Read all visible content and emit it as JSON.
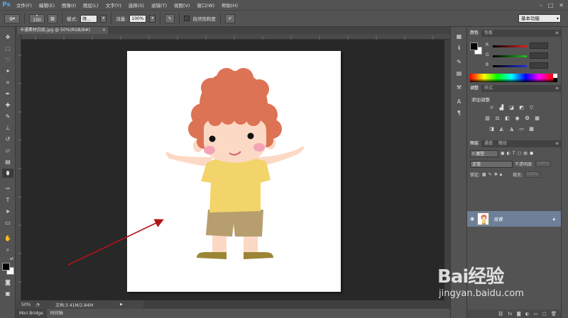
{
  "menubar": {
    "logo": "Ps",
    "items": [
      "文件(F)",
      "编辑(E)",
      "图像(I)",
      "图层(L)",
      "文字(Y)",
      "选择(S)",
      "滤镜(T)",
      "视图(V)",
      "窗口(W)",
      "帮助(H)"
    ],
    "window_controls": [
      "–",
      "□",
      "✕"
    ]
  },
  "options": {
    "brush_size": "150",
    "mode_label": "模式:",
    "mode_value": "降...",
    "flow_label": "流量:",
    "flow_value": "100%",
    "checkbox_label": "自然饱和度",
    "workspace": "基本功能"
  },
  "document": {
    "tab_title": "卡通素材白底.jpg @ 50%(RGB/8#)",
    "tab_close": "×",
    "zoom": "50%",
    "info": "文档:3.41M/2.84M",
    "arrow_color": "#b01515"
  },
  "bottom_tabs": [
    "Mini Bridge",
    "时间轴"
  ],
  "color_panel": {
    "tabs": [
      "颜色",
      "色板"
    ],
    "sliders": [
      {
        "letter": "R",
        "color": "#e02020"
      },
      {
        "letter": "G",
        "color": "#20c020"
      },
      {
        "letter": "B",
        "color": "#2030e0"
      }
    ]
  },
  "adjustments_panel": {
    "tabs": [
      "调整",
      "样式"
    ],
    "title": "添加调整"
  },
  "layers_panel": {
    "tabs": [
      "图层",
      "通道",
      "路径"
    ],
    "filter_label": "类型",
    "blend_mode": "正常",
    "opacity_label": "不透明度:",
    "opacity_value": "100%",
    "lock_label": "锁定:",
    "fill_label": "填充:",
    "fill_value": "100%",
    "layer_name": "背景",
    "layer_highlight": "#6e7f97"
  },
  "watermark": {
    "logo": "Bai经验",
    "url": "jingyan.baidu.com"
  }
}
